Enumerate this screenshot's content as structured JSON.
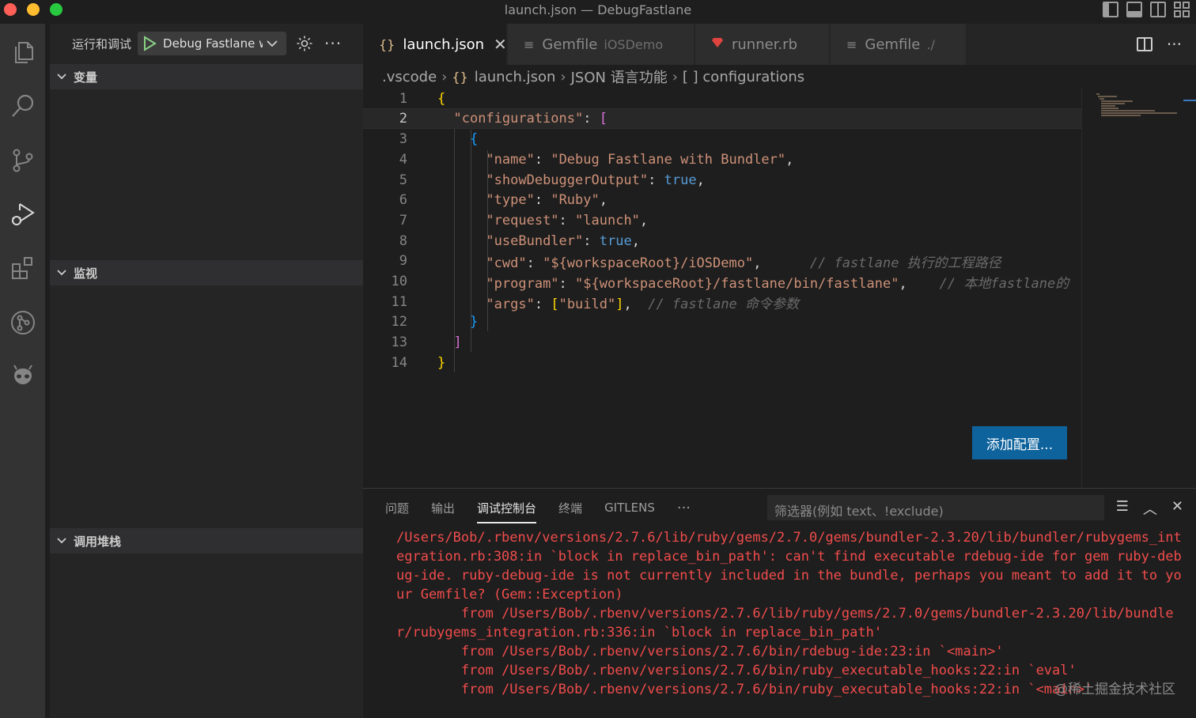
{
  "window": {
    "title": "launch.json — DebugFastlane"
  },
  "sidebar": {
    "run_title": "运行和调试",
    "config_select": "Debug Fastlane with Bundler",
    "sections": [
      "变量",
      "监视",
      "调用堆栈"
    ]
  },
  "tabs": [
    {
      "label": "launch.json",
      "hint": "",
      "icon": "{}",
      "active": true
    },
    {
      "label": "Gemfile",
      "hint": "iOSDemo",
      "icon": "≡",
      "active": false
    },
    {
      "label": "runner.rb",
      "hint": "",
      "icon": "ruby",
      "active": false
    },
    {
      "label": "Gemfile",
      "hint": "./",
      "icon": "≡",
      "active": false
    }
  ],
  "breadcrumb": [
    ".vscode",
    "launch.json",
    "JSON 语言功能",
    "[ ] configurations"
  ],
  "editor": {
    "current_line": 2,
    "line_numbers": [
      "1",
      "2",
      "3",
      "4",
      "5",
      "6",
      "7",
      "8",
      "9",
      "10",
      "11",
      "12",
      "13",
      "14"
    ],
    "lines": {
      "l4_key": "\"name\"",
      "l4_val": "\"Debug Fastlane with Bundler\"",
      "l5_key": "\"showDebuggerOutput\"",
      "l5_val": "true",
      "l6_key": "\"type\"",
      "l6_val": "\"Ruby\"",
      "l7_key": "\"request\"",
      "l7_val": "\"launch\"",
      "l8_key": "\"useBundler\"",
      "l8_val": "true",
      "l9_key": "\"cwd\"",
      "l9_val": "\"${workspaceRoot}/iOSDemo\"",
      "l9_cmt": "// fastlane 执行的工程路径",
      "l10_key": "\"program\"",
      "l10_val": "\"${workspaceRoot}/fastlane/bin/fastlane\"",
      "l10_cmt": "// 本地fastlane的",
      "l11_key": "\"args\"",
      "l11_val": "\"build\"",
      "l11_cmt": "// fastlane 命令参数",
      "l2_key": "\"configurations\""
    },
    "add_config_button": "添加配置..."
  },
  "panel": {
    "tabs": [
      "问题",
      "输出",
      "调试控制台",
      "终端",
      "GITLENS"
    ],
    "active_tab": "调试控制台",
    "filter_placeholder": "筛选器(例如 text、!exclude)",
    "console_text": "/Users/Bob/.rbenv/versions/2.7.6/lib/ruby/gems/2.7.0/gems/bundler-2.3.20/lib/bundler/rubygems_integration.rb:308:in `block in replace_bin_path': can't find executable rdebug-ide for gem ruby-debug-ide. ruby-debug-ide is not currently included in the bundle, perhaps you meant to add it to your Gemfile? (Gem::Exception)\n        from /Users/Bob/.rbenv/versions/2.7.6/lib/ruby/gems/2.7.0/gems/bundler-2.3.20/lib/bundler/rubygems_integration.rb:336:in `block in replace_bin_path'\n        from /Users/Bob/.rbenv/versions/2.7.6/bin/rdebug-ide:23:in `<main>'\n        from /Users/Bob/.rbenv/versions/2.7.6/bin/ruby_executable_hooks:22:in `eval'\n        from /Users/Bob/.rbenv/versions/2.7.6/bin/ruby_executable_hooks:22:in `<main>'",
    "watermark": "@稀土掘金技术社区"
  },
  "colors": {
    "accent_button": "#0e639c",
    "error_text": "#f14c4c",
    "string": "#ce9178",
    "boolean": "#569cd6"
  }
}
